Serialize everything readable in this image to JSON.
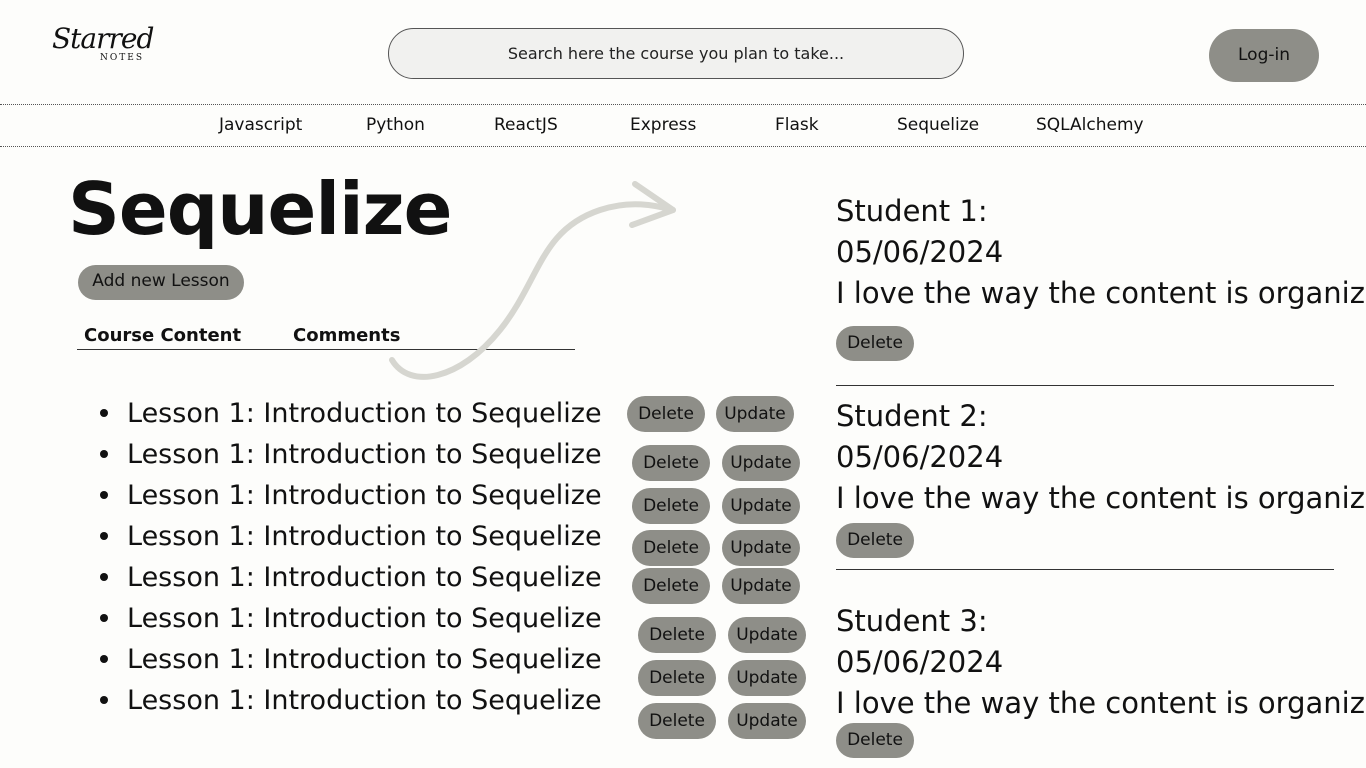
{
  "logo": {
    "script": "Starred",
    "sub": "NOTES"
  },
  "search": {
    "placeholder": "Search here the course you plan to take..."
  },
  "header": {
    "login_label": "Log-in"
  },
  "nav": [
    "Javascript",
    "Python",
    "ReactJS",
    "Express",
    "Flask",
    "Sequelize",
    "SQLAlchemy"
  ],
  "course": {
    "title": "Sequelize",
    "add_lesson_label": "Add new Lesson",
    "tabs": [
      "Course Content",
      "Comments"
    ],
    "lessons": [
      {
        "title": "Lesson 1: Introduction to Sequelize",
        "delete": "Delete",
        "update": "Update"
      },
      {
        "title": "Lesson 1: Introduction to Sequelize",
        "delete": "Delete",
        "update": "Update"
      },
      {
        "title": "Lesson 1: Introduction to Sequelize",
        "delete": "Delete",
        "update": "Update"
      },
      {
        "title": "Lesson 1: Introduction to Sequelize",
        "delete": "Delete",
        "update": "Update"
      },
      {
        "title": "Lesson 1: Introduction to Sequelize",
        "delete": "Delete",
        "update": "Update"
      },
      {
        "title": "Lesson 1: Introduction to Sequelize",
        "delete": "Delete",
        "update": "Update"
      },
      {
        "title": "Lesson 1: Introduction to Sequelize",
        "delete": "Delete",
        "update": "Update"
      },
      {
        "title": "Lesson 1: Introduction to Sequelize",
        "delete": "Delete",
        "update": "Update"
      }
    ]
  },
  "comments": [
    {
      "author": "Student 1:",
      "date": "05/06/2024",
      "text": "I love the way the content is organized",
      "delete": "Delete"
    },
    {
      "author": "Student 2:",
      "date": "05/06/2024",
      "text": "I love the way the content is organized",
      "delete": "Delete"
    },
    {
      "author": "Student 3:",
      "date": "05/06/2024",
      "text": "I love the way the content is organized",
      "delete": "Delete"
    }
  ],
  "colors": {
    "background": "#fdfdfb",
    "pill": "#8e8e88",
    "search_bg": "#f1f1ef",
    "arrow": "#d6d6d0"
  },
  "icons": {
    "decor_arrow": "curved-arrow-icon"
  }
}
